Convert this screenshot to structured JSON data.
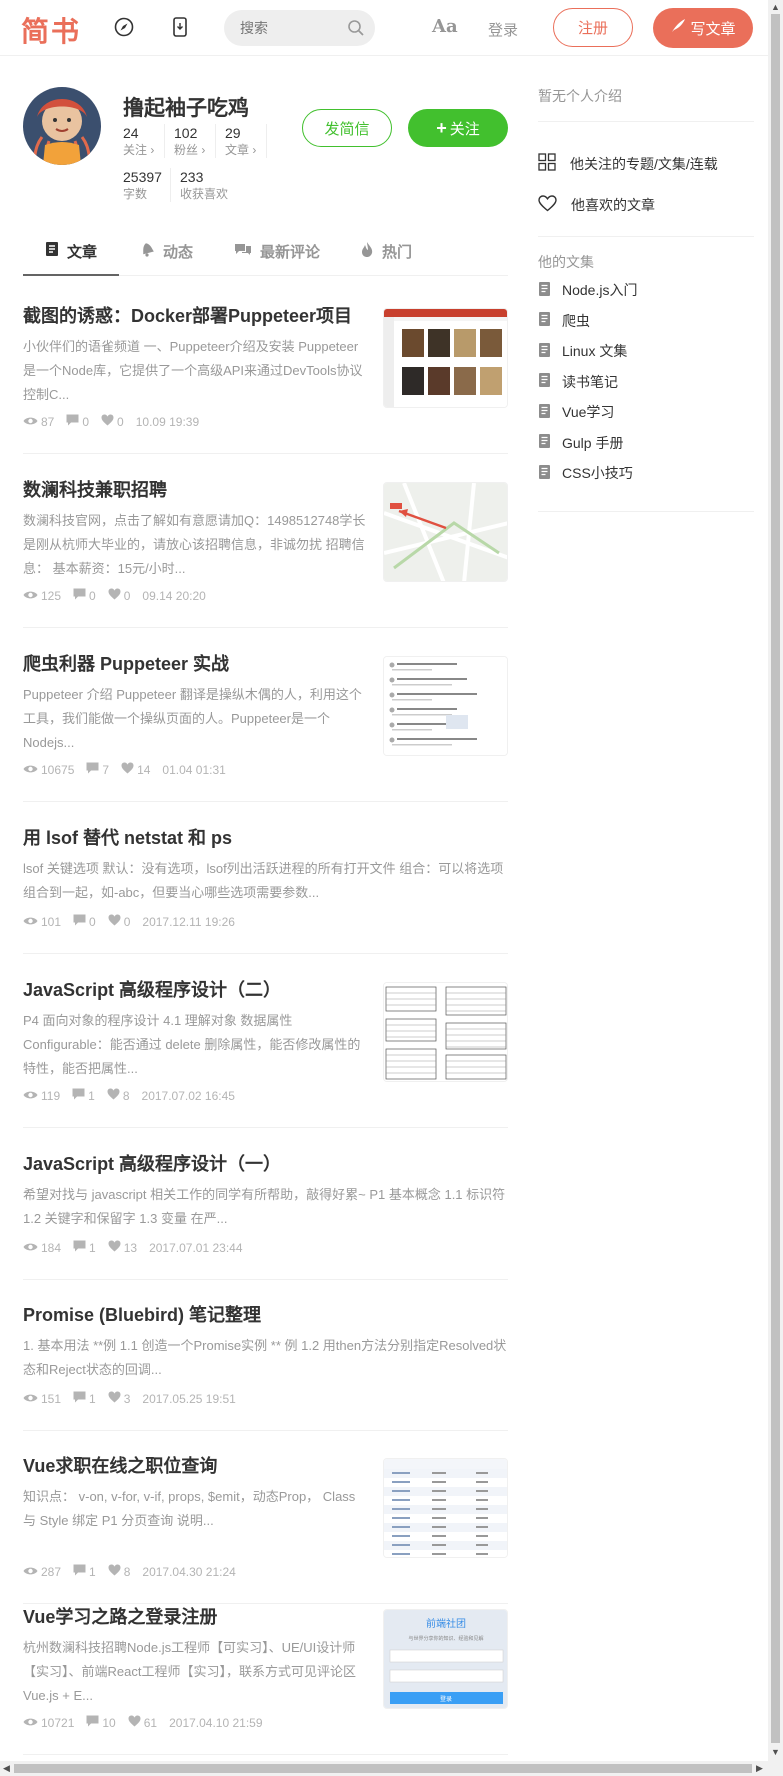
{
  "header": {
    "logo": "简书",
    "search_placeholder": "搜索",
    "font_toggle": "Aa",
    "login": "登录",
    "signup": "注册",
    "write": "写文章",
    "accent": "#ea6f5a"
  },
  "profile": {
    "name": "撸起袖子吃鸡",
    "stats": [
      {
        "num": "24",
        "label": "关注 ›"
      },
      {
        "num": "102",
        "label": "粉丝 ›"
      },
      {
        "num": "29",
        "label": "文章 ›"
      },
      {
        "num": "25397",
        "label": "字数"
      },
      {
        "num": "233",
        "label": "收获喜欢"
      }
    ],
    "message_btn": "发简信",
    "follow_btn": "关注",
    "follow_color": "#42c02e"
  },
  "tabs": [
    {
      "label": "文章",
      "icon": "document-icon"
    },
    {
      "label": "动态",
      "icon": "bell-icon"
    },
    {
      "label": "最新评论",
      "icon": "comments-icon"
    },
    {
      "label": "热门",
      "icon": "fire-icon"
    }
  ],
  "articles": [
    {
      "title": "截图的诱惑：Docker部署Puppeteer项目",
      "abstract": "小伙伴们的语雀频道 一、Puppeteer介绍及安装 Puppeteer 是一个Node库，它提供了一个高级API来通过DevTools协议控制C...",
      "views": "87",
      "comments": "0",
      "likes": "0",
      "time": "10.09 19:39"
    },
    {
      "title": "数澜科技兼职招聘",
      "abstract": "数澜科技官网，点击了解如有意愿请加Q：1498512748学长是刚从杭师大毕业的，请放心该招聘信息，非诚勿扰 招聘信息： 基本薪资：15元/小时...",
      "views": "125",
      "comments": "0",
      "likes": "0",
      "time": "09.14 20:20"
    },
    {
      "title": "爬虫利器 Puppeteer 实战",
      "abstract": "Puppeteer 介绍 Puppeteer 翻译是操纵木偶的人，利用这个工具，我们能做一个操纵页面的人。Puppeteer是一个Nodejs...",
      "views": "10675",
      "comments": "7",
      "likes": "14",
      "time": "01.04 01:31"
    },
    {
      "title": "用 lsof 替代 netstat 和 ps",
      "abstract": "lsof 关键选项 默认：没有选项，lsof列出活跃进程的所有打开文件 组合：可以将选项组合到一起，如-abc，但要当心哪些选项需要参数...",
      "views": "101",
      "comments": "0",
      "likes": "0",
      "time": "2017.12.11 19:26"
    },
    {
      "title": "JavaScript 高级程序设计（二）",
      "abstract": "P4 面向对象的程序设计 4.1 理解对象 数据属性 Configurable：能否通过 delete 删除属性，能否修改属性的特性，能否把属性...",
      "views": "119",
      "comments": "1",
      "likes": "8",
      "time": "2017.07.02 16:45"
    },
    {
      "title": "JavaScript 高级程序设计（一）",
      "abstract": "希望对找与 javascript 相关工作的同学有所帮助，敲得好累~ P1 基本概念 1.1 标识符 1.2 关键字和保留字 1.3 变量 在严...",
      "views": "184",
      "comments": "1",
      "likes": "13",
      "time": "2017.07.01 23:44"
    },
    {
      "title": "Promise (Bluebird) 笔记整理",
      "abstract": "1. 基本用法 **例 1.1 创造一个Promise实例 ** 例 1.2 用then方法分别指定Resolved状态和Reject状态的回调...",
      "views": "151",
      "comments": "1",
      "likes": "3",
      "time": "2017.05.25 19:51"
    },
    {
      "title": "Vue求职在线之职位查询",
      "abstract": "知识点： v-on, v-for, v-if, props, $emit，动态Prop， Class 与 Style 绑定 P1 分页查询 说明...",
      "views": "287",
      "comments": "1",
      "likes": "8",
      "time": "2017.04.30 21:24"
    },
    {
      "title": "Vue学习之路之登录注册",
      "abstract": "杭州数澜科技招聘Node.js工程师【可实习】、UE/UI设计师【实习】、前端React工程师【实习】，联系方式可见评论区 Vue.js + E...",
      "views": "10721",
      "comments": "10",
      "likes": "61",
      "time": "2017.04.10 21:59"
    }
  ],
  "thumb_text": {
    "login_site": "前端社团",
    "login_slogan": "与世界分享你的知识、经验和见解",
    "login_btn": "登录"
  },
  "sidebar": {
    "intro": "暂无个人介绍",
    "links": [
      {
        "label": "他关注的专题/文集/连载",
        "icon": "grid-icon"
      },
      {
        "label": "他喜欢的文章",
        "icon": "heart-icon"
      }
    ],
    "collections_title": "他的文集",
    "collections": [
      "Node.js入门",
      "爬虫",
      "Linux 文集",
      "读书笔记",
      "Vue学习",
      "Gulp 手册",
      "CSS小技巧"
    ]
  }
}
